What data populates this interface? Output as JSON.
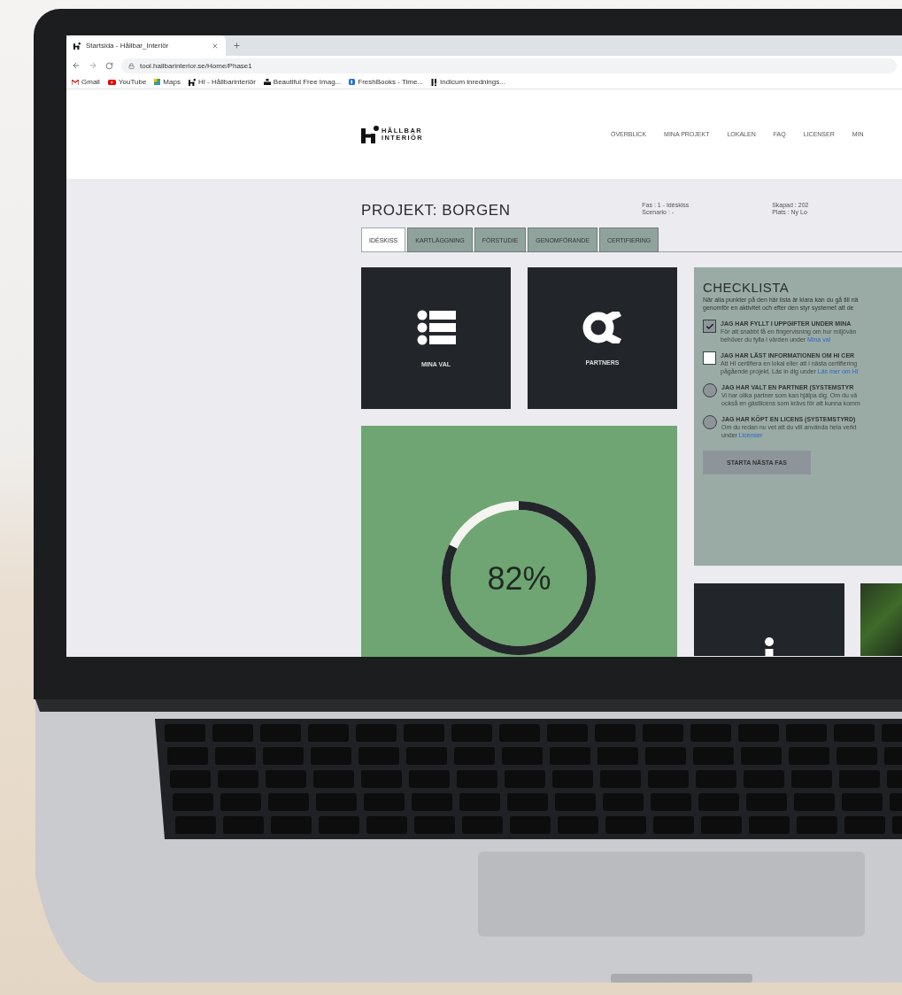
{
  "browser": {
    "tab": {
      "title": "Startsida - Hållbar_Interiör"
    },
    "url": "tool.hallbarinterior.se/Home/Phase1",
    "bookmarks": [
      {
        "kind": "gmail",
        "label": "Gmail"
      },
      {
        "kind": "youtube",
        "label": "YouTube"
      },
      {
        "kind": "maps",
        "label": "Maps"
      },
      {
        "kind": "hi",
        "label": "HI - Hållbarinteriör"
      },
      {
        "kind": "unsplash",
        "label": "Beautiful Free Imag..."
      },
      {
        "kind": "freshbooks",
        "label": "FreshBooks - Time..."
      },
      {
        "kind": "indicum",
        "label": "Indicum inrednings..."
      }
    ]
  },
  "header": {
    "logo": [
      "HÅLLBAR",
      "INTERIÖR"
    ],
    "nav": [
      "ÖVERBLICK",
      "MINA PROJEKT",
      "LOKALEN",
      "FAQ",
      "LICENSER",
      "MIN"
    ]
  },
  "project": {
    "title": "PROJEKT: BORGEN",
    "meta_left": [
      "Fas : 1 - Idéskiss",
      "Scenario : -"
    ],
    "meta_right": [
      "Skapad : 202",
      "Plats : Ny Lo"
    ]
  },
  "phase_tabs": [
    {
      "label": "IDÉSKISS",
      "selected": true
    },
    {
      "label": "KARTLÄGGNING",
      "selected": false
    },
    {
      "label": "FÖRSTUDIE",
      "selected": false
    },
    {
      "label": "GENOMFÖRANDE",
      "selected": false
    },
    {
      "label": "CERTIFIERING",
      "selected": false
    }
  ],
  "tiles": [
    {
      "kind": "list",
      "label": "MINA VAL"
    },
    {
      "kind": "partners",
      "label": "PARTNERS"
    }
  ],
  "progress": {
    "level": 0.82,
    "reading": "82%"
  },
  "checklist": {
    "title": "CHECKLISTA",
    "intro": [
      "När alla punkter på den här lista är klara kan du gå till nä",
      "genomför en aktivitet och efter den styr systemet att de"
    ],
    "items": [
      {
        "kind": "checkbox",
        "checked": true,
        "title": "JAG HAR FYLLT I UPPGIFTER UNDER MINA",
        "lines": [
          {
            "text": "För att snabbt få en fingervisning om hur miljövän"
          },
          {
            "text": "behöver du fylla i värden under ",
            "link": "Mina val"
          }
        ]
      },
      {
        "kind": "checkbox",
        "checked": false,
        "title": "JAG HAR LÄST INFORMATIONEN OM HI CER",
        "lines": [
          {
            "text": "Att HI certifiera en lokal eller att i nästa certifiering"
          },
          {
            "text": "pågående projekt. Läs in dig under ",
            "link": "Läs mer om HI"
          }
        ]
      },
      {
        "kind": "status",
        "title": "JAG HAR VALT EN PARTNER (SYSTEMSTYR",
        "lines": [
          {
            "text": "Vi har olika partner som kan hjälpa dig. Om du vä"
          },
          {
            "text": "också en gästlicens som krävs för att kunna komm"
          }
        ]
      },
      {
        "kind": "status",
        "title": "JAG HAR KÖPT EN LICENS (SYSTEMSTYRD)",
        "lines": [
          {
            "text": "Om du redan nu vet att du vill använda hela verkt"
          },
          {
            "text": "under ",
            "link": "Licenser"
          }
        ]
      }
    ],
    "button": "STARTA NÄSTA FAS"
  }
}
